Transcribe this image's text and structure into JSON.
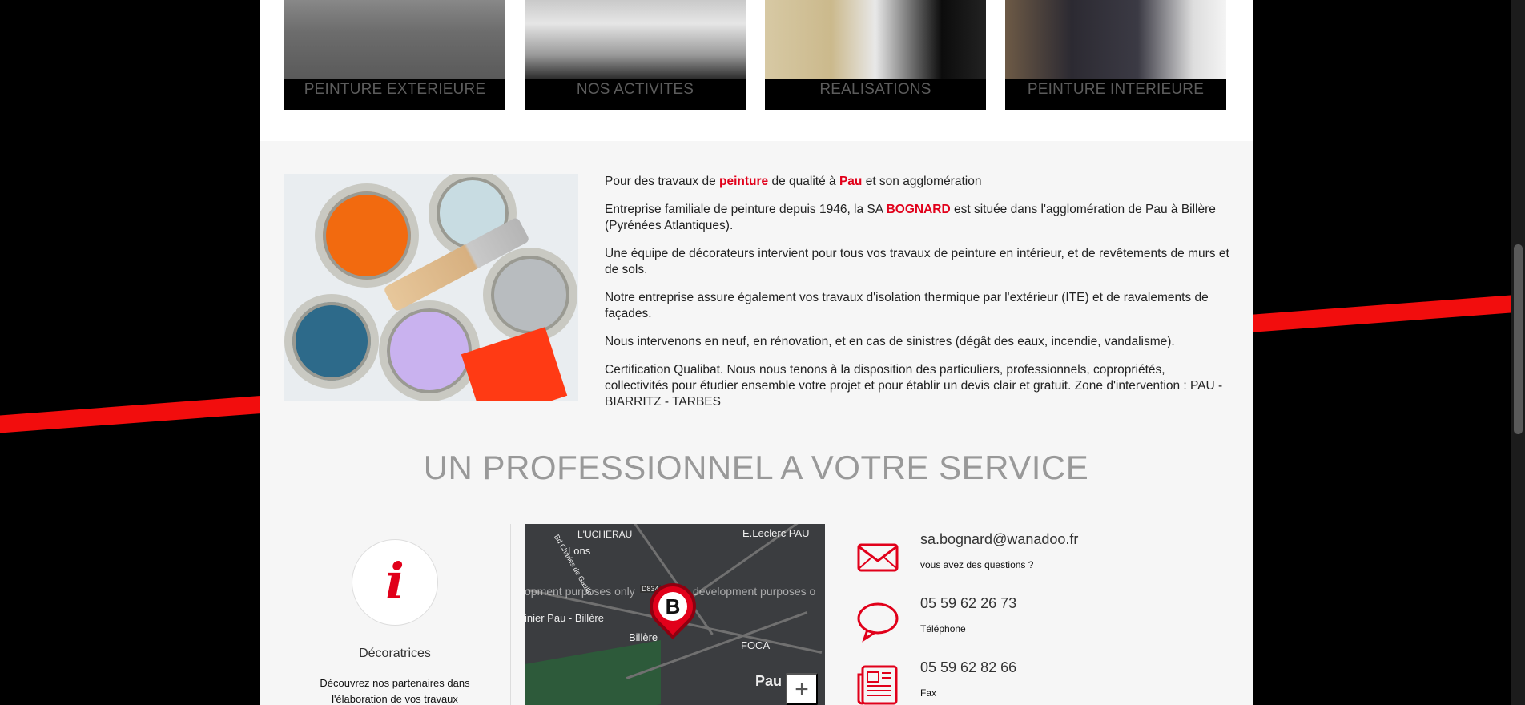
{
  "tiles": [
    {
      "caption": "PEINTURE EXTERIEURE"
    },
    {
      "caption": "NOS ACTIVITES"
    },
    {
      "caption": "REALISATIONS"
    },
    {
      "caption": "PEINTURE INTERIEURE"
    }
  ],
  "intro": {
    "p1_a": "Pour des travaux de ",
    "p1_b": "peinture",
    "p1_c": " de qualité à ",
    "p1_d": "Pau",
    "p1_e": " et son agglomération",
    "p2_a": "Entreprise familiale de peinture depuis 1946, la SA ",
    "p2_b": "BOGNARD",
    "p2_c": " est située dans l'agglomération de Pau à Billère (Pyrénées Atlantiques).",
    "p3": "Une équipe de décorateurs intervient pour tous vos travaux de peinture en intérieur, et de revêtements de murs et de sols.",
    "p4": "Notre entreprise assure également vos travaux d'isolation thermique par l'extérieur (ITE) et de ravalements de façades.",
    "p5": "Nous intervenons en neuf, en rénovation, et en cas de sinistres (dégât des eaux, incendie, vandalisme).",
    "p6": "Certification Qualibat. Nous nous tenons à la disposition des particuliers, professionnels, copropriétés, collectivités pour étudier ensemble votre projet et pour établir un devis clair et gratuit. Zone d'intervention : PAU - BIARRITZ - TARBES"
  },
  "section_title": "UN PROFESSIONNEL A VOTRE SERVICE",
  "feature": {
    "icon_letter": "i",
    "title": "Décoratrices",
    "description": "Découvrez nos partenaires dans l'élaboration de vos travaux"
  },
  "map": {
    "labels": {
      "loucherau": "L'UCHERAU",
      "lons": "Lons",
      "eleclerc": "E.Leclerc PAU",
      "d834": "D834",
      "dev_left": "opment purposes only",
      "dev_right": "development purposes o",
      "jardinerie": "inier Pau - Billère",
      "billere": "Billère",
      "foca": "FOCA",
      "pau": "Pau",
      "road": "Bd Charles de Gaulle"
    },
    "pin_letter": "B",
    "zoom_in": "+"
  },
  "contact": {
    "email": "sa.bognard@wanadoo.fr",
    "email_label": "vous avez des questions ?",
    "phone": "05 59 62 26 73",
    "phone_label": "Téléphone",
    "fax": "05 59 62 82 66",
    "fax_label": "Fax"
  },
  "colors": {
    "accent": "#e1001a",
    "stripe": "#f20d0d",
    "background": "#000000",
    "content_bg": "#f6f6f6"
  }
}
